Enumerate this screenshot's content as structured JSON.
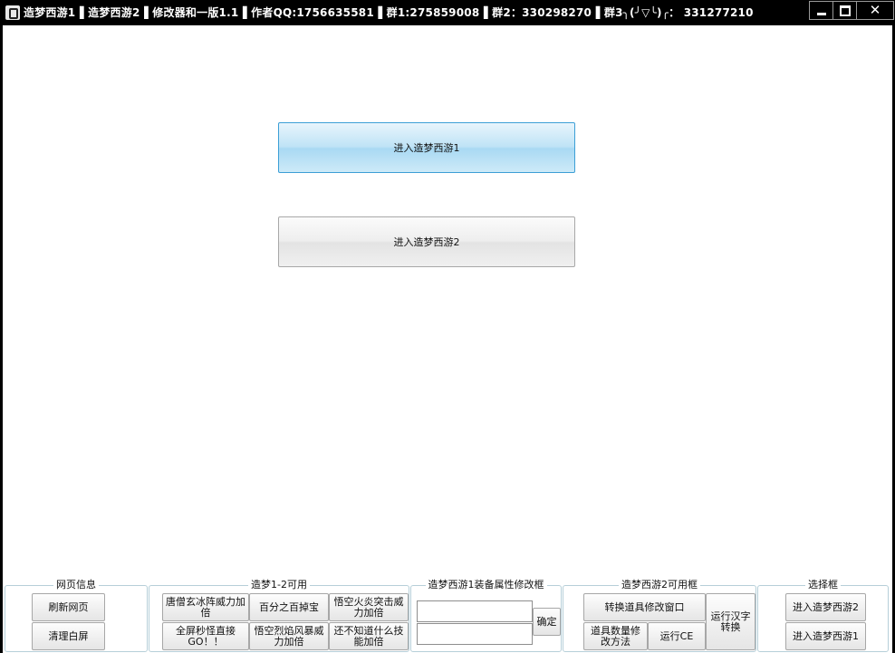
{
  "window": {
    "title": "造梦西游1▐ 造梦西游2▐ 修改器和一版1.1▐ 作者QQ:1756635581▐ 群1:275859008▐ 群2：330298270▐ 群3╮(╯▽╰)╭： 331277210"
  },
  "main": {
    "enter_game1": "进入造梦西游1",
    "enter_game2": "进入造梦西游2"
  },
  "groups": {
    "web_info": {
      "title": "网页信息",
      "refresh": "刷新网页",
      "clear": "清理白屏"
    },
    "both_games": {
      "title": "造梦1-2可用",
      "tang_ice": "唐僧玄冰阵威力加倍",
      "treasure": "百分之百掉宝",
      "wukong_fire": "悟空火炎突击威力加倍",
      "instant_kill": "全屏秒怪直接GO！！",
      "wukong_storm": "悟空烈焰风暴威力加倍",
      "unknown_skill": "还不知道什么技能加倍"
    },
    "equip_editor": {
      "title": "造梦西游1装备属性修改框",
      "confirm": "确定",
      "field1_value": "",
      "field2_value": ""
    },
    "game2": {
      "title": "造梦西游2可用框",
      "convert_window": "转换道具修改窗口",
      "run_hanzi": "运行汉字转换",
      "item_qty": "道具数量修改方法",
      "run_ce": "运行CE"
    },
    "select": {
      "title": "选择框",
      "enter2": "进入造梦西游2",
      "enter1": "进入造梦西游1"
    }
  }
}
